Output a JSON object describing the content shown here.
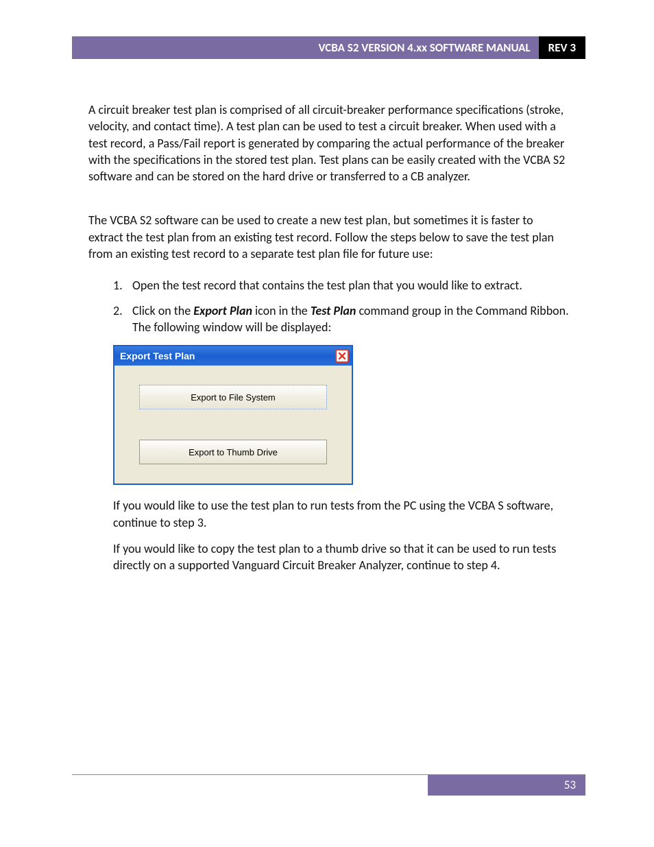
{
  "header": {
    "title": "VCBA S2 VERSION 4.xx SOFTWARE MANUAL",
    "rev": "REV 3"
  },
  "body": {
    "p1": "A circuit breaker test plan is comprised of all circuit-breaker performance specifications (stroke, velocity, and contact time). A test plan can be used to test a circuit breaker. When used with a test record, a Pass/Fail report is generated by comparing the actual performance of the breaker with the specifications in the stored test plan. Test plans can be easily created with the VCBA S2 software and can be stored on the hard drive or transferred to a CB analyzer.",
    "p2": "The VCBA S2 software can be used to create a new test plan, but sometimes it is faster to extract the test plan from an existing test record. Follow the steps below to save the test plan from an existing test record to a separate test plan file for future use:",
    "steps": [
      {
        "num": "1.",
        "text": "Open the test record that contains the test plan that you would like to extract."
      },
      {
        "num": "2.",
        "pre": "Click on the ",
        "b1": "Export Plan",
        "mid": " icon in the ",
        "b2": "Test Plan",
        "post": " command group in the Command Ribbon. The following window will be displayed:"
      }
    ],
    "after1": "If you would like to use the test plan to run tests from the PC using the VCBA S software, continue to step 3.",
    "after2": "If you would like to copy the test plan to a thumb drive so that it can be used to run tests directly on a supported Vanguard Circuit Breaker Analyzer, continue to step 4."
  },
  "dialog": {
    "title": "Export Test Plan",
    "btn1": "Export to File System",
    "btn2": "Export to Thumb Drive"
  },
  "footer": {
    "page": "53"
  }
}
